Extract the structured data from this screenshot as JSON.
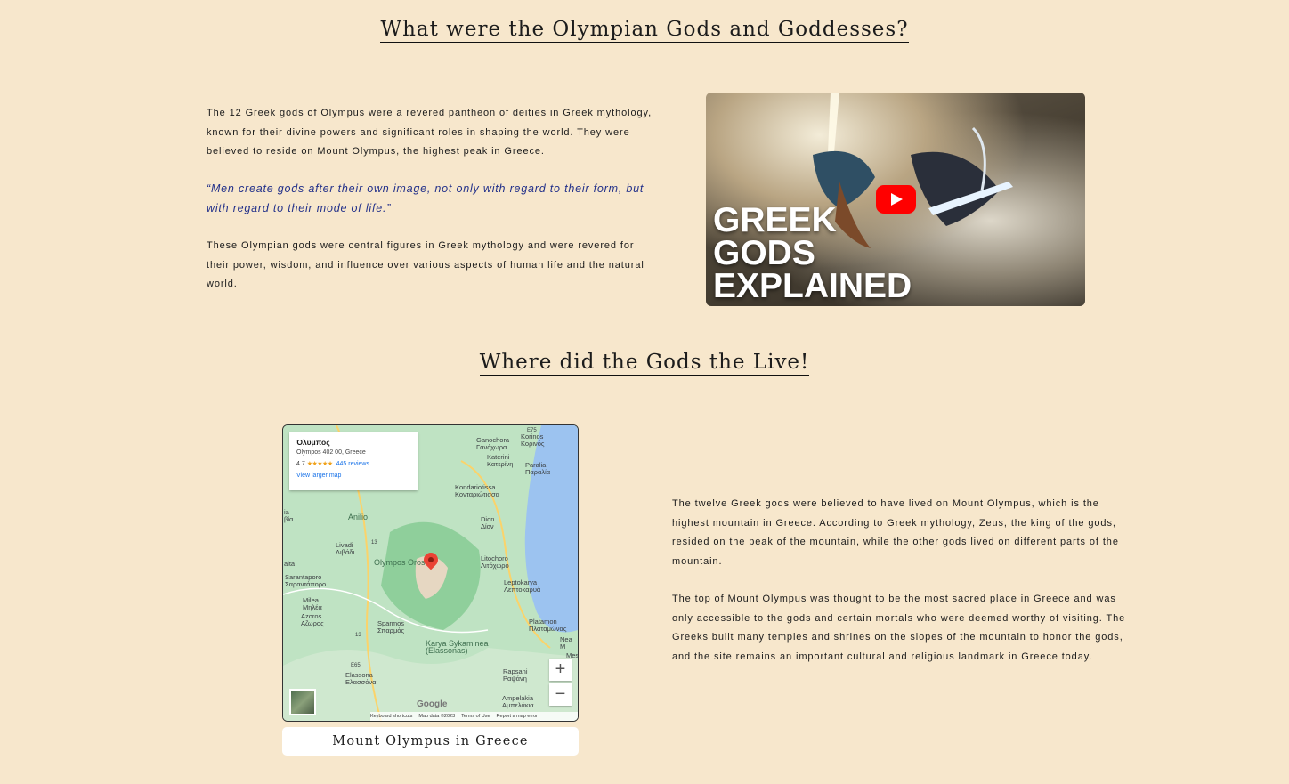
{
  "section1": {
    "heading": "What were the Olympian Gods and Goddesses?",
    "paragraph1": "The 12 Greek gods of Olympus were a revered pantheon of deities in Greek mythology, known for their divine powers and significant roles in shaping the world. They were believed to reside on Mount Olympus, the highest peak in Greece.",
    "quote": "“Men create gods after their own image, not only with regard to their form, but with regard to their mode of life.”",
    "paragraph2": "These Olympian gods were central figures in Greek mythology and were revered for their power, wisdom, and influence over various aspects of human life and the natural world.",
    "video": {
      "title_line1": "GREEK",
      "title_line2": "GODS",
      "title_line3": "EXPLAINED",
      "play_icon": "youtube-play-icon"
    }
  },
  "section2": {
    "heading": "Where did the Gods the Live!",
    "paragraph1": "The twelve Greek gods were believed to have lived on Mount Olympus, which is the highest mountain in Greece. According to Greek mythology, Zeus, the king of the gods, resided on the peak of the mountain, while the other gods lived on different parts of the mountain.",
    "paragraph2": "The top of Mount Olympus was thought to be the most sacred place in Greece and was only accessible to the gods and certain mortals who were deemed worthy of visiting. The Greeks built many temples and shrines on the slopes of the mountain to honor the gods, and the site remains an important cultural and religious landmark in Greece today.",
    "caption": "Mount Olympus in Greece"
  },
  "map": {
    "place_name": "Όλυμπος",
    "address": "Olympos 402 00, Greece",
    "rating": "4.7",
    "stars": "★★★★★",
    "reviews": "445 reviews",
    "larger_map": "View larger map",
    "zoom_in": "+",
    "zoom_out": "−",
    "google": "Google",
    "footer": {
      "shortcuts": "Keyboard shortcuts",
      "data": "Map data ©2023",
      "terms": "Terms of Use",
      "report": "Report a map error"
    },
    "labels": {
      "ganochora": "Ganochora\nΓανόχωρα",
      "korinos": "Korinos\nΚορινός",
      "katerini": "Katerini\nΚατερίνη",
      "paralia": "Paralia\nΠαραλία",
      "kondariotissa": "Kondariotissa\nΚονταριώτισσα",
      "dion": "Dion\nΔίον",
      "anilio": "Anilio",
      "livadi": "Livadi\nΛιβάδι",
      "olympos": "Olympos Oros",
      "litochoro": "Litochoro\nΛιτόχωρο",
      "sarantaporo": "Sarantaporo\nΣαραντάπορο",
      "leptokarya": "Leptokarya\nΛεπτοκαρυά",
      "milea": "Milea\nΜηλέα",
      "azoros": "Azoros\nΑζωρος",
      "sparmos": "Sparmos\nΣπαρμός",
      "platamon": "Platamon\nΠλαταμώνας",
      "karya": "Karya Sykaminea\n(Elassonas)",
      "nea": "Nea M",
      "elassona": "Elassona\nΕλασσόνα",
      "rapsani": "Rapsani\nΡαψάνη",
      "ampelakia": "Ampelakia\nΑμπελάκια",
      "e75": "E75",
      "r13a": "13",
      "r13b": "13",
      "e65": "E65",
      "ia": "ia\nβία",
      "alta": "alta",
      "mes": "Mes"
    }
  }
}
